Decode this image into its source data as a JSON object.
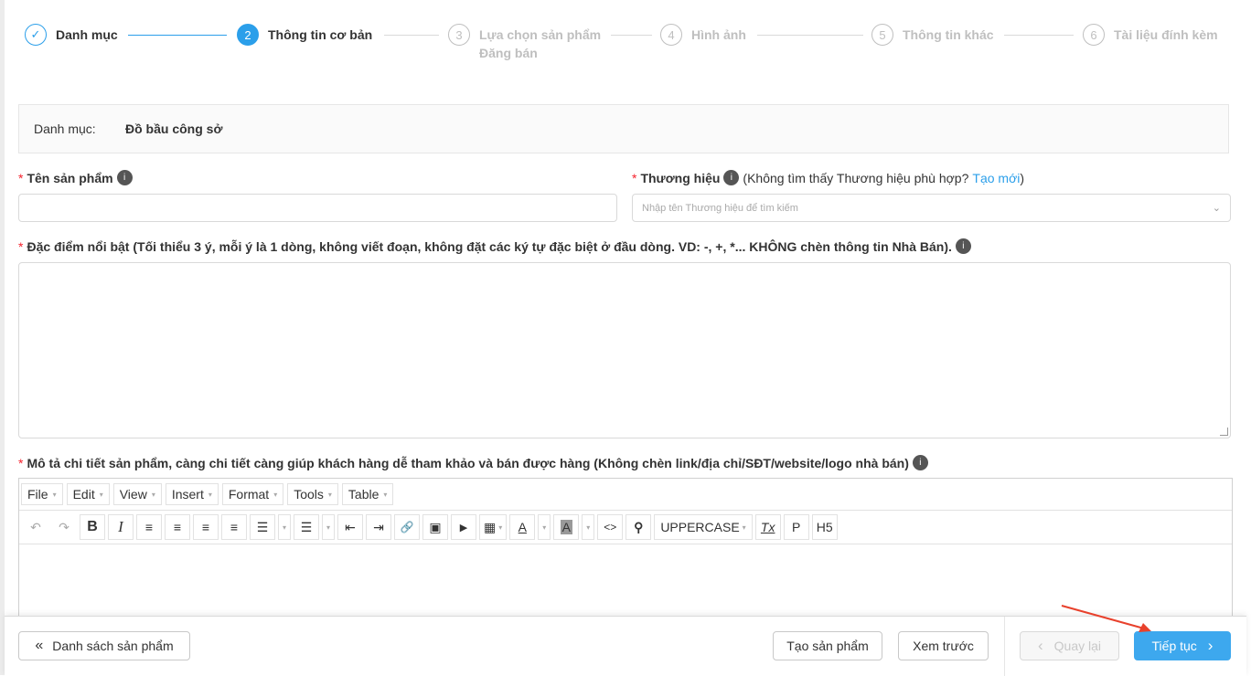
{
  "stepper": {
    "steps": [
      {
        "num": "✓",
        "label": "Danh mục",
        "label2": ""
      },
      {
        "num": "2",
        "label": "Thông tin cơ bản",
        "label2": ""
      },
      {
        "num": "3",
        "label": "Lựa chọn sản phẩm",
        "label2": "Đăng bán"
      },
      {
        "num": "4",
        "label": "Hình ảnh",
        "label2": ""
      },
      {
        "num": "5",
        "label": "Thông tin khác",
        "label2": ""
      },
      {
        "num": "6",
        "label": "Tài liệu đính kèm",
        "label2": ""
      }
    ]
  },
  "category": {
    "label": "Danh mục:",
    "value": "Đồ bầu công sở"
  },
  "fields": {
    "product_name": {
      "required": "*",
      "label": "Tên sản phẩm",
      "info": "i"
    },
    "brand": {
      "required": "*",
      "label": "Thương hiệu",
      "info": "i",
      "hint_prefix": "(Không tìm thấy Thương hiệu phù hợp?",
      "hint_link": "Tạo mới",
      "hint_suffix": ")",
      "placeholder": "Nhập tên Thương hiệu để tìm kiếm",
      "chevron": "⌄"
    },
    "highlights": {
      "required": "*",
      "label": "Đặc điểm nổi bật (Tối thiểu 3 ý, mỗi ý là 1 dòng, không viết đoạn, không đặt các ký tự đặc biệt ở đầu dòng. VD: -, +, *... KHÔNG chèn thông tin Nhà Bán).",
      "info": "i"
    },
    "description": {
      "required": "*",
      "label": "Mô tả chi tiết sản phẩm, càng chi tiết càng giúp khách hàng dễ tham khảo và bán được hàng (Không chèn link/địa chỉ/SĐT/website/logo nhà bán)",
      "info": "i"
    }
  },
  "editor": {
    "menus": [
      "File",
      "Edit",
      "View",
      "Insert",
      "Format",
      "Tools",
      "Table"
    ],
    "caret": "▾",
    "toolbar": {
      "undo": "↶",
      "redo": "↷",
      "bold": "B",
      "italic": "I",
      "align_left": "≡",
      "align_center": "≡",
      "align_right": "≡",
      "justify": "≡",
      "bullet_list": "☰",
      "numbered_list": "☰",
      "outdent": "⇤",
      "indent": "⇥",
      "link": "🔗",
      "image": "▣",
      "media": "▶",
      "table": "▦",
      "text_color": "A",
      "bg_color": "A",
      "code": "<>",
      "find": "⚲",
      "uppercase": "UPPERCASE",
      "clear_format": "Tx",
      "paragraph": "P",
      "heading": "H5"
    }
  },
  "footer": {
    "back_list_icon": "«",
    "back_list": "Danh sách sản phẩm",
    "create": "Tạo sản phẩm",
    "preview": "Xem trước",
    "prev_icon": "‹",
    "prev": "Quay lại",
    "next": "Tiếp tục",
    "next_icon": "›"
  },
  "colors": {
    "accent": "#2b9fea",
    "required": "#f5222d",
    "annotation_arrow": "#e8412c"
  }
}
